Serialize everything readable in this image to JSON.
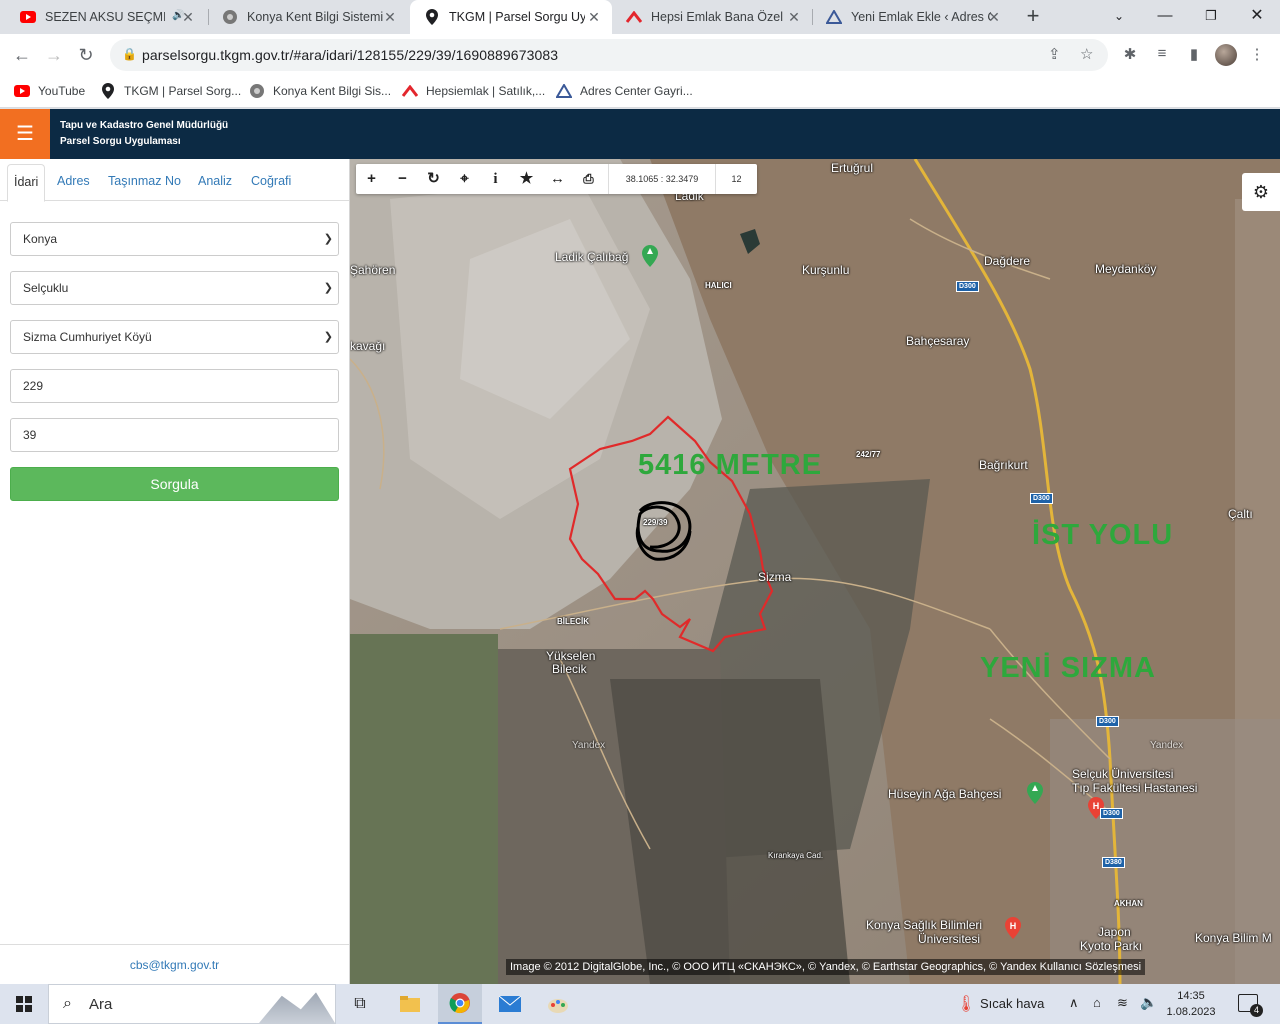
{
  "browser": {
    "tabs": [
      {
        "title": "SEZEN AKSU SEÇME ŞARKILAR",
        "icon": "youtube-icon",
        "audio": "🔊"
      },
      {
        "title": "Konya Kent Bilgi Sistemi",
        "icon": "konya-icon"
      },
      {
        "title": "TKGM | Parsel Sorgu Uygulaması",
        "icon": "location-pin-icon",
        "active": true
      },
      {
        "title": "Hepsi Emlak Bana Özel",
        "icon": "hepsiemlak-icon"
      },
      {
        "title": "Yeni Emlak Ekle ‹ Adres Center",
        "icon": "adrescenter-icon"
      }
    ],
    "url": "parselsorgu.tkgm.gov.tr/#ara/idari/128155/229/39/1690889673083",
    "bookmarks": [
      {
        "label": "YouTube",
        "icon": "youtube-icon"
      },
      {
        "label": "TKGM | Parsel Sorg...",
        "icon": "location-pin-icon"
      },
      {
        "label": "Konya Kent Bilgi Sis...",
        "icon": "konya-icon"
      },
      {
        "label": "Hepsiemlak | Satılık,...",
        "icon": "hepsiemlak-icon"
      },
      {
        "label": "Adres Center Gayri...",
        "icon": "adrescenter-icon"
      }
    ]
  },
  "app": {
    "title_line1": "Tapu ve Kadastro Genel Müdürlüğü",
    "title_line2": "Parsel Sorgu Uygulaması",
    "menu_icon": "☰"
  },
  "panel": {
    "tabs": [
      "İdari",
      "Adres",
      "Taşınmaz No",
      "Analiz",
      "Coğrafi"
    ],
    "active_tab": "İdari",
    "il": "Konya",
    "ilce": "Selçuklu",
    "mahalle": "Sizma Cumhuriyet Köyü",
    "ada": "229",
    "parsel": "39",
    "submit_label": "Sorgula",
    "footer_email": "cbs@tkgm.gov.tr"
  },
  "map": {
    "coordinates": "38.1065 : 32.3479",
    "zoom": "12",
    "parcel_label": "229/39",
    "attribution": "Image © 2012 DigitalGlobe, Inc., © ООО ИТЦ «СКАНЭКС», © Yandex, © Earthstar Geographics, © Yandex Kullanıcı Sözleşmesi",
    "annotations": [
      "5416 METRE",
      "İST YOLU",
      "YENİ SIZMA"
    ],
    "places": {
      "ertugrul": "Ertuğrul",
      "ladik": "Ladik",
      "ladik_calibag": "Ladik Çalıbağ",
      "halici": "HALICI",
      "kursunlu": "Kurşunlu",
      "dagdere": "Dağdere",
      "meydankoy": "Meydanköy",
      "sahoren": "Şahören",
      "kavagi": "kavağı",
      "bahcesaray": "Bahçesaray",
      "bagrikurt": "Bağrıkurt",
      "sizma": "Sizma",
      "calti": "Çaltı",
      "bilecik": "BİLECİK",
      "yukselen": "Yükselen",
      "bilecik2": "Bilecik",
      "yandex1": "Yandex",
      "yandex2": "Yandex",
      "huseyin": "Hüseyin Ağa Bahçesi",
      "selcuk1": "Selçuk Üniversitesi",
      "selcuk2": "Tıp Fakültesi Hastanesi",
      "akhan": "AKHAN",
      "ksbu1": "Konya Sağlık Bilimleri",
      "ksbu2": "Üniversitesi",
      "japon1": "Japon",
      "japon2": "Kyoto Parkı",
      "konyabilim": "Konya Bilim M",
      "kirankaya": "Kırankaya Cad.",
      "km": "242/77"
    },
    "roads": [
      "D300",
      "D300",
      "D300",
      "D300",
      "D380"
    ]
  },
  "taskbar": {
    "search_placeholder": "Ara",
    "weather": "Sıcak hava",
    "time": "14:35",
    "date": "1.08.2023",
    "notifications": "4"
  }
}
